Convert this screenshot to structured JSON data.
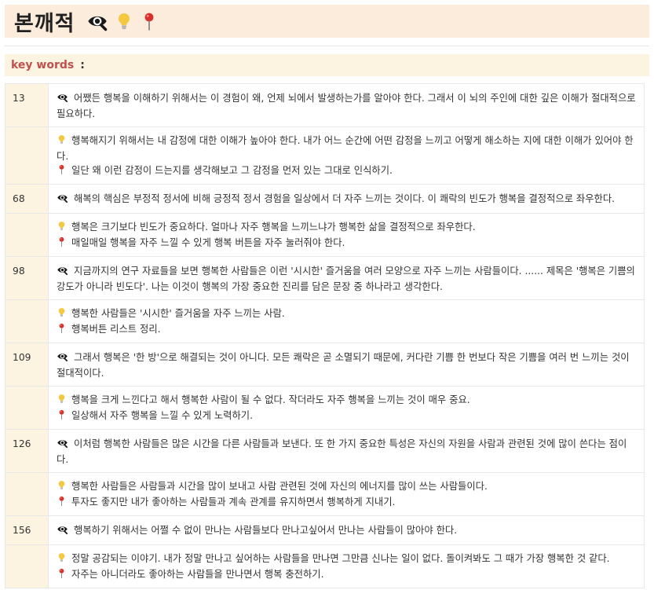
{
  "header": {
    "title": "본깨적",
    "icons": [
      "eye-icon",
      "lightbulb-icon",
      "pushpin-icon"
    ]
  },
  "keywords": {
    "label": "key words",
    "separator": ":"
  },
  "colors": {
    "title_bg": "#fcecdc",
    "keyword_bg": "#fdf3e1",
    "keyword_label": "#c0504d",
    "lightbulb": "#f5c842",
    "pin": "#d9302a"
  },
  "entries": [
    {
      "page": "13",
      "quote": "어쨌든 행복을 이해하기 위해서는 이 경험이 왜, 언제 뇌에서 발생하는가를 알아야 한다. 그래서 이 뇌의 주인에 대한 깊은 이해가 절대적으로 필요하다.",
      "realize": "행복해지기 위해서는 내 감정에 대한 이해가 높아야 한다. 내가 어느 순간에 어떤 감정을 느끼고 어떻게 해소하는 지에 대한 이해가 있어야 한다.",
      "apply": "일단 왜 이런 감정이 드는지를 생각해보고 그 감정을 먼저 있는 그대로 인식하기."
    },
    {
      "page": "68",
      "quote": "해복의 핵심은 부정적 정서에 비해 긍정적 정서 경험을 일상에서 더 자주 느끼는 것이다. 이 쾌락의 빈도가 행복을 결정적으로 좌우한다.",
      "realize": "행복은 크기보다 빈도가 중요하다. 얼마나 자주 행복을 느끼느냐가 행복한 삶을 결정적으로 좌우한다.",
      "apply": "매일매일 행복을 자주 느낄 수 있게 행복 버튼을 자주 눌러줘야 한다."
    },
    {
      "page": "98",
      "quote": "지금까지의 연구 자료들을 보면 행복한 사람들은 이런 '시시한' 즐거움을 여러 모양으로 자주 느끼는 사람들이다. ...... 제목은 '행복은 기쁨의 강도가 아니라 빈도다'. 나는 이것이 행복의 가장 중요한 진리를 담은 문장 중 하나라고 생각한다.",
      "realize": "행복한 사람들은 '시시한' 즐거움을 자주 느끼는 사람.",
      "apply": "행복버튼 리스트 정리."
    },
    {
      "page": "109",
      "quote": "그래서 행복은 '한 방'으로 해결되는 것이 아니다. 모든 쾌락은 곧 소멸되기 때문에, 커다란 기쁨 한 번보다 작은 기쁨을 여러 번 느끼는 것이 절대적이다.",
      "realize": "행복을 크게 느낀다고 해서 행복한 사람이 될 수 없다. 작더라도 자주 행복을 느끼는 것이 매우 중요.",
      "apply": "일상해서 자주 행복을 느낄 수 있게 노력하기."
    },
    {
      "page": "126",
      "quote": "이처럼 행복한 사람들은 많은 시간을 다른 사람들과 보낸다. 또 한 가지 중요한 특성은 자신의 자원을 사람과 관련된 것에 많이 쓴다는 점이다.",
      "realize": "행복한 사람들은 사람들과 시간을 많이 보내고 사람 관련된 것에 자신의 에너지를 많이 쓰는 사람들이다.",
      "apply": "투자도 좋지만 내가 좋아하는 사람들과 계속 관계를 유지하면서 행복하게 지내기."
    },
    {
      "page": "156",
      "quote": "행복하기 위해서는 어쩔 수 없이 만나는 사람들보다 만나고싶어서 만나는 사람들이 많아야 한다.",
      "realize": "정말 공감되는 이야기. 내가 정말 만나고 싶어하는 사람들을 만나면 그만큼 신나는 일이 없다. 돌이켜봐도 그 때가 가장 행복한 것 같다.",
      "apply": "자주는 아니더라도 좋아하는 사람들을 만나면서 행복 충전하기."
    }
  ]
}
